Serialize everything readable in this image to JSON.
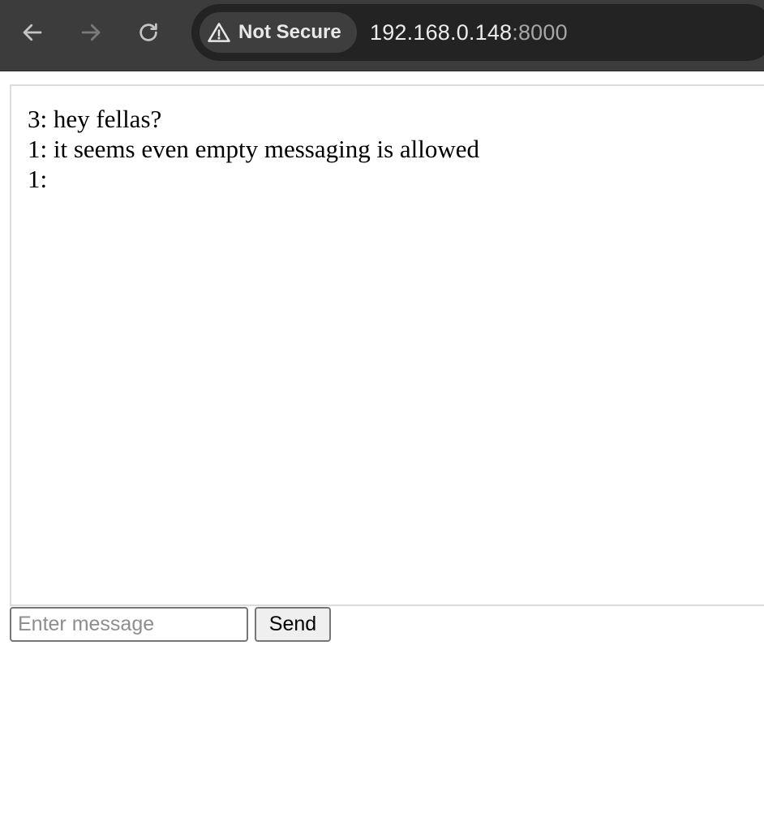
{
  "browser": {
    "back_icon": "arrow-left-icon",
    "forward_icon": "arrow-right-icon",
    "reload_icon": "reload-icon",
    "security_icon": "warning-triangle-icon",
    "security_label": "Not Secure",
    "url_host": "192.168.0.148",
    "url_port": ":8000",
    "toolbar_color": "#3c3c3c"
  },
  "chat": {
    "messages": [
      {
        "text": "3: hey fellas?"
      },
      {
        "text": "1: it seems even empty messaging is allowed"
      },
      {
        "text": "1:"
      }
    ]
  },
  "composer": {
    "input_value": "",
    "input_placeholder": "Enter message",
    "send_label": "Send"
  }
}
